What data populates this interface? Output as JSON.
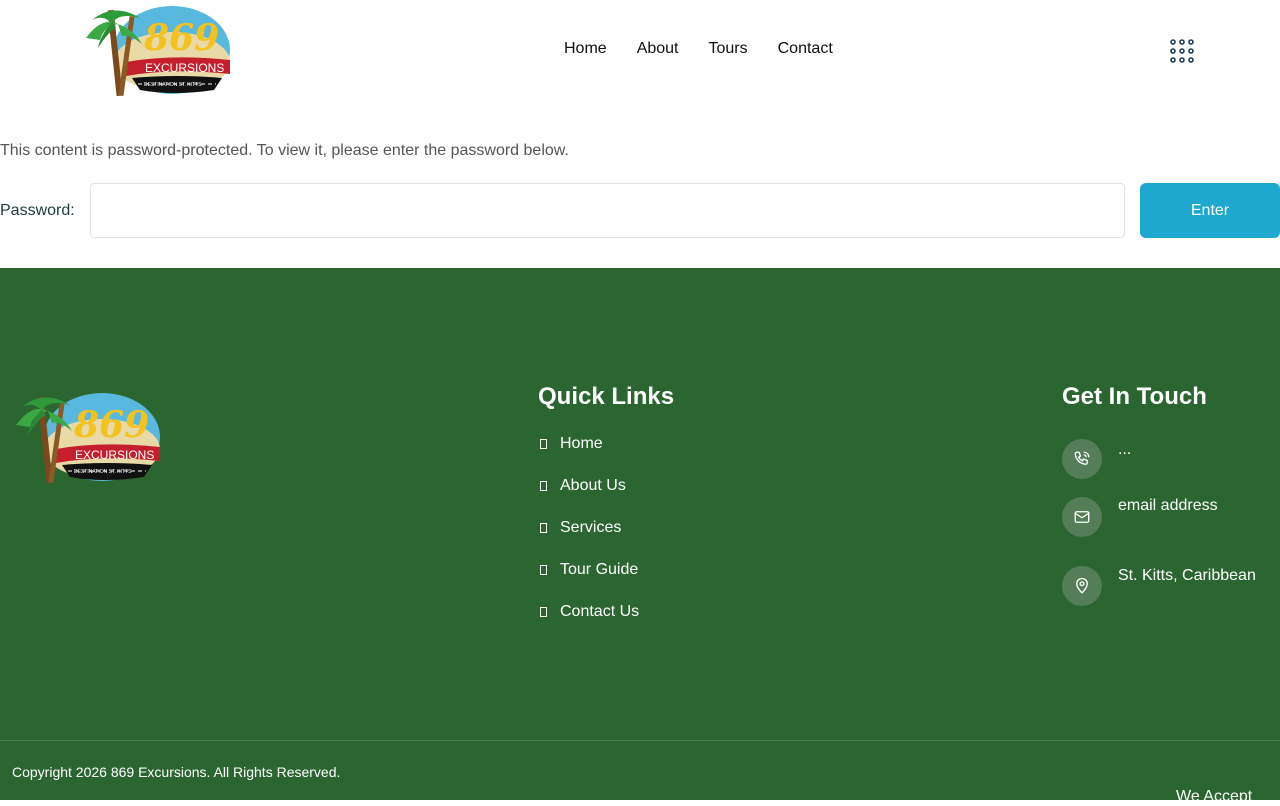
{
  "brand": {
    "logo_number": "869",
    "logo_word": "EXCURSIONS",
    "logo_tagline": "DESTINATION ST. KITTS"
  },
  "nav": {
    "items": [
      "Home",
      "About",
      "Tours",
      "Contact"
    ]
  },
  "protected": {
    "message": "This content is password-protected. To view it, please enter the password below.",
    "password_label": "Password:",
    "password_value": "",
    "enter_label": "Enter"
  },
  "footer": {
    "quick_links_title": "Quick Links",
    "quick_links": [
      "Home",
      "About Us",
      "Services",
      "Tour Guide",
      "Contact Us"
    ],
    "get_in_touch_title": "Get In Touch",
    "phone": "...",
    "email": "email address",
    "location": "St. Kitts, Caribbean",
    "copyright": "Copyright 2026 869 Excursions. All Rights Reserved.",
    "we_accept": "We Accept"
  },
  "colors": {
    "accent": "#1ea7cf",
    "footer_bg": "#2b6530"
  },
  "icons": {
    "menu": "grid-dots-icon",
    "phone": "phone-icon",
    "email": "envelope-icon",
    "location": "map-pin-icon",
    "link_bullet": "square-bullet-icon"
  }
}
